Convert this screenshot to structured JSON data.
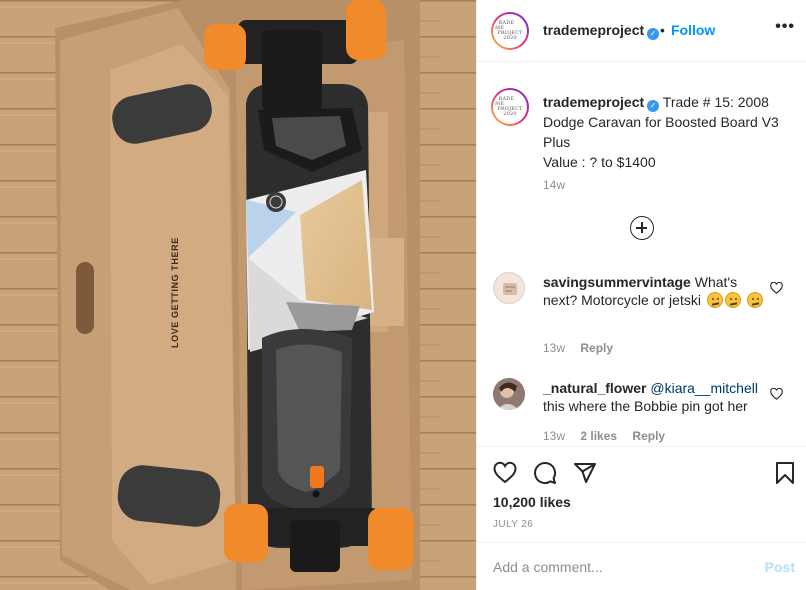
{
  "post": {
    "username": "trademeproject",
    "verified": true,
    "follow_label": "Follow",
    "dot": "•",
    "more_label": "•••",
    "avatar_text": [
      "TRADE ME",
      "PROJECT",
      "2020"
    ],
    "image_alt": "Boosted Board V3 Plus electric skateboard in its cardboard box",
    "box_print": "LOVE GETTING THERE",
    "caption": {
      "username": "trademeproject",
      "text": "Trade # 15: 2008 Dodge Caravan for Boosted Board V3 Plus",
      "value_line": "Value : ? to $1400",
      "time": "14w"
    },
    "comments": [
      {
        "username": "savingsummervintage",
        "text": "What's next? Motorcycle or jetski",
        "emojis": [
          "thinking-face",
          "thinking-face",
          "thinking-face"
        ],
        "time": "13w",
        "reply_label": "Reply"
      },
      {
        "username": "_natural_flower",
        "mention": "@kiara__mitchell",
        "text": "this where the Bobbie pin got her",
        "time": "13w",
        "likes_label": "2 likes",
        "reply_label": "Reply"
      }
    ],
    "likes": "10,200 likes",
    "date": "JULY 26",
    "add_comment_placeholder": "Add a comment...",
    "post_label": "Post"
  }
}
